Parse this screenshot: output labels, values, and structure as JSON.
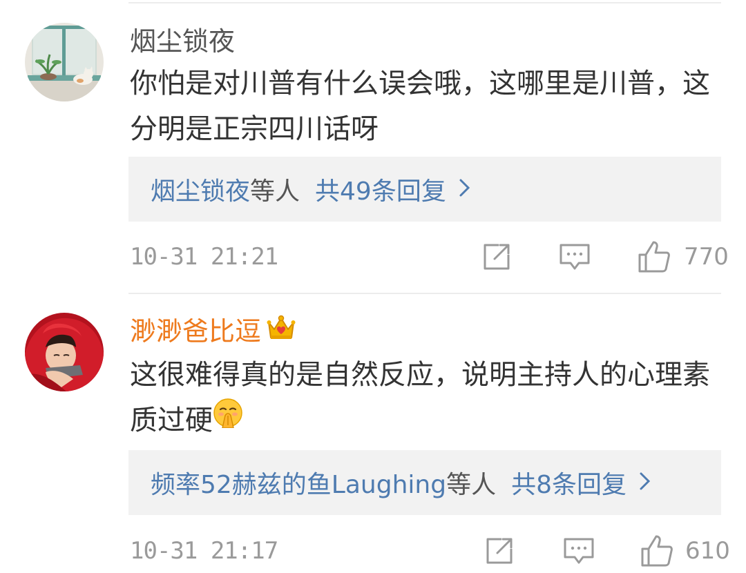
{
  "comments": [
    {
      "username": "烟尘锁夜",
      "content": "你怕是对川普有什么误会哦，这哪里是川普，这分明是正宗四川话呀",
      "reply_users": "烟尘锁夜",
      "reply_suffix": "等人",
      "reply_count": "共49条回复",
      "timestamp": "10-31 21:21",
      "likes": "770",
      "avatar_icon": "window-cat-avatar"
    },
    {
      "username": "渺渺爸比逗",
      "badge_icon": "crown-icon",
      "content": "这很难得真的是自然反应，说明主持人的心理素质过硬",
      "content_emoji": "shushing-face-emoji",
      "reply_users": "频率52赫兹的鱼Laughing",
      "reply_suffix": "等人",
      "reply_count": "共8条回复",
      "timestamp": "10-31 21:17",
      "likes": "610",
      "avatar_icon": "red-hood-child-avatar"
    }
  ],
  "colors": {
    "link": "#4e7bb0",
    "vip_name": "#ee7a1d",
    "meta": "#9a9a9a",
    "reply_bg": "#f2f2f2"
  }
}
